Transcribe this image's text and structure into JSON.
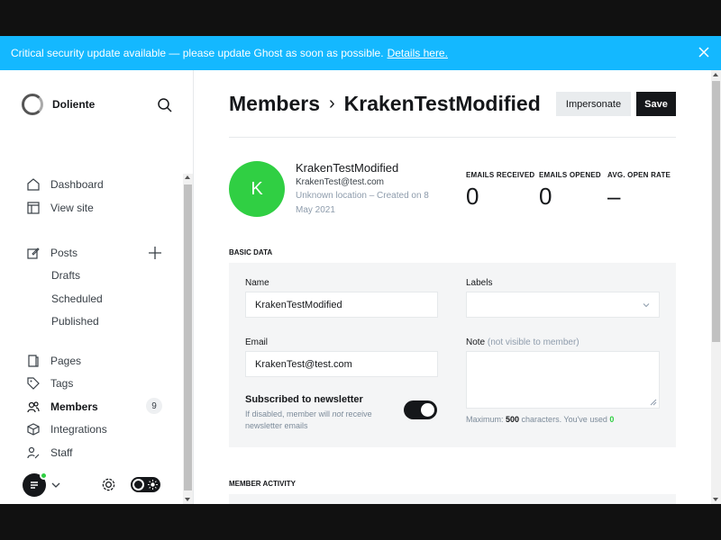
{
  "banner": {
    "message": "Critical security update available — please update Ghost as soon as possible.",
    "link": "Details here.",
    "bg_color": "#14b8ff"
  },
  "sidebar": {
    "site_name": "Doliente",
    "nav": [
      {
        "label": "Dashboard",
        "icon": "home-icon"
      },
      {
        "label": "View site",
        "icon": "layout-icon"
      },
      {
        "label": "Posts",
        "icon": "edit-icon"
      },
      {
        "label": "Pages",
        "icon": "pages-icon"
      },
      {
        "label": "Tags",
        "icon": "tag-icon"
      },
      {
        "label": "Members",
        "icon": "members-icon",
        "active": true,
        "count": "9"
      },
      {
        "label": "Integrations",
        "icon": "integrations-icon"
      },
      {
        "label": "Staff",
        "icon": "staff-icon"
      }
    ],
    "posts_sub": [
      "Drafts",
      "Scheduled",
      "Published"
    ]
  },
  "header": {
    "crumb_parent": "Members",
    "separator": "›",
    "crumb_current": "KrakenTestModified",
    "impersonate_label": "Impersonate",
    "save_label": "Save"
  },
  "member": {
    "initial": "K",
    "name": "KrakenTestModified",
    "email": "KrakenTest@test.com",
    "meta": "Unknown location – Created on 8 May 2021",
    "avatar_color": "#30cf43"
  },
  "stats": [
    {
      "label": "EMAILS RECEIVED",
      "value": "0"
    },
    {
      "label": "EMAILS OPENED",
      "value": "0"
    },
    {
      "label": "AVG. OPEN RATE",
      "value": "–"
    }
  ],
  "basic_data": {
    "heading": "BASIC DATA",
    "name_label": "Name",
    "name_value": "KrakenTestModified",
    "labels_label": "Labels",
    "email_label": "Email",
    "email_value": "KrakenTest@test.com",
    "note_label": "Note",
    "note_hint": "(not visible to member)",
    "subscribed_label": "Subscribed to newsletter",
    "subscribed_hint_pre": "If disabled, member will ",
    "subscribed_hint_em": "not",
    "subscribed_hint_post": " receive newsletter emails",
    "subscribed": true,
    "max_pre": "Maximum: ",
    "max_value": "500",
    "max_mid": " characters. You've used ",
    "used_value": "0"
  },
  "activity": {
    "heading": "MEMBER ACTIVITY"
  }
}
